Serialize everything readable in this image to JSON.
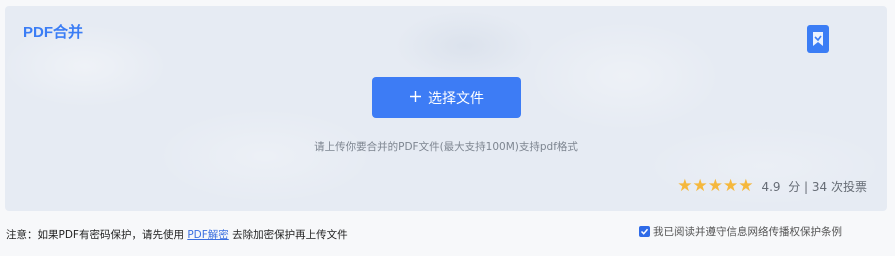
{
  "panel": {
    "title": "PDF合并",
    "tool_icon": "bookmark-pdf-icon",
    "select_button": {
      "icon": "plus-icon",
      "label": "选择文件"
    },
    "hint": "请上传你要合并的PDF文件(最大支持100M)支持pdf格式",
    "rating": {
      "stars": "★★★★★",
      "score": "4.9",
      "unit": "分",
      "separator": "|",
      "votes": "34 次投票"
    }
  },
  "footer": {
    "note_prefix": "注意：如果PDF有密码保护，请先使用",
    "note_link": "PDF解密",
    "note_suffix": "去除加密保护再上传文件",
    "agree_checked": true,
    "agree_label": "我已阅读并遵守信息网络传播权保护条例"
  },
  "colors": {
    "accent": "#3d7cf5",
    "panel_bg": "#e6ebf3",
    "star": "#f5b83d"
  }
}
